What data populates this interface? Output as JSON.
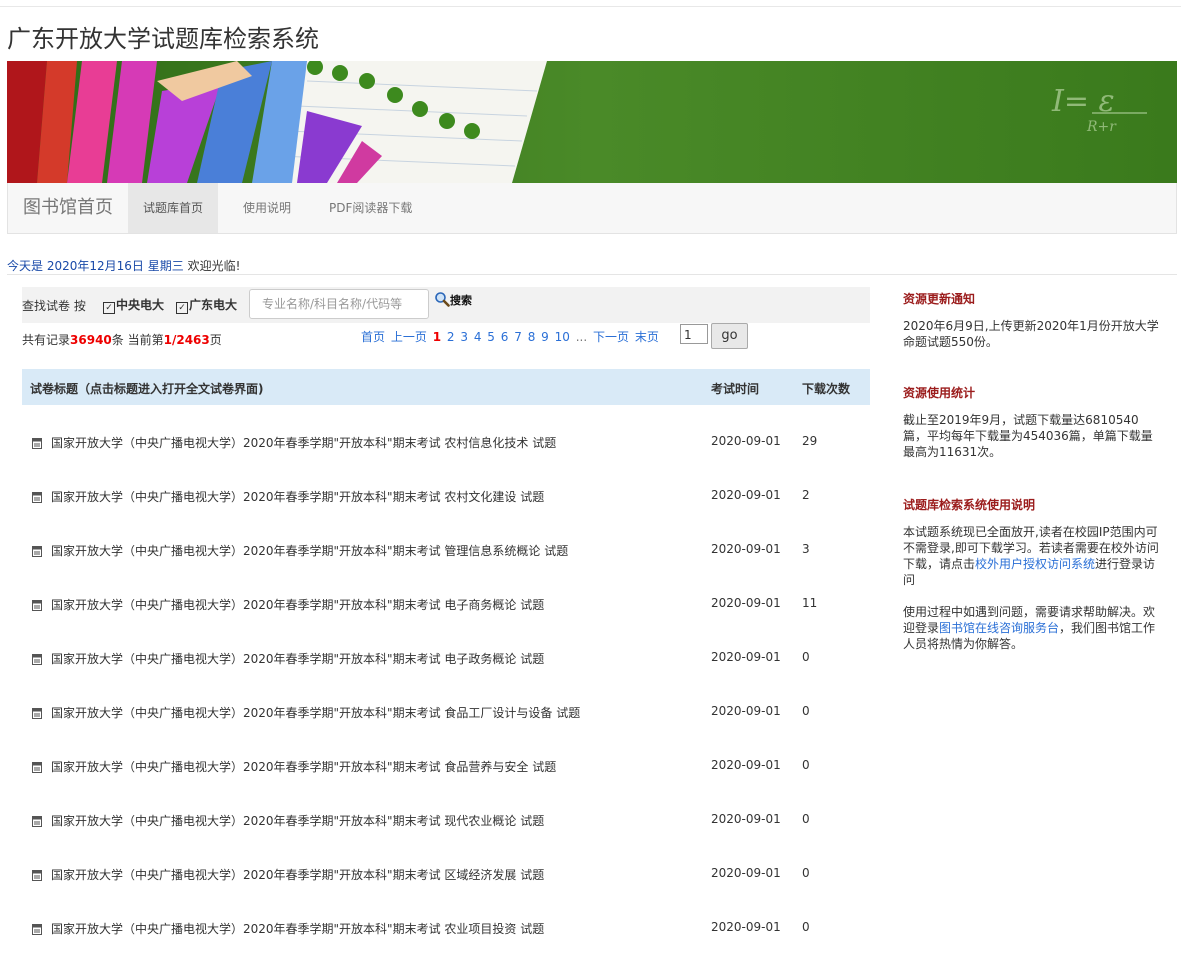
{
  "site_title": "广东开放大学试题库检索系统",
  "nav": {
    "brand": "图书馆首页",
    "items": [
      "试题库首页",
      "使用说明",
      "PDF阅读器下载"
    ]
  },
  "date_line": {
    "prefix": "今天是",
    "date": "2020年12月16日",
    "weekday": "星期三",
    "welcome": "欢迎光临!"
  },
  "search": {
    "label": "查找试卷 按",
    "check1": "中央电大",
    "check2": "广东电大",
    "placeholder": "专业名称/科目名称/代码等",
    "button": "搜索"
  },
  "records": {
    "prefix": "共有记录",
    "total": "36940",
    "mid": "条 当前第",
    "current": "1",
    "slash": "/",
    "pages": "2463",
    "suffix": "页"
  },
  "pager": {
    "first": "首页",
    "prev": "上一页",
    "pages": [
      "1",
      "2",
      "3",
      "4",
      "5",
      "6",
      "7",
      "8",
      "9",
      "10"
    ],
    "dots": "...",
    "next": "下一页",
    "last": "末页",
    "input_value": "1",
    "go": "go"
  },
  "table": {
    "headers": [
      "试卷标题（点击标题进入打开全文试卷界面)",
      "考试时间",
      "下载次数"
    ],
    "rows": [
      {
        "title": "国家开放大学（中央广播电视大学）2020年春季学期\"开放本科\"期末考试 农村信息化技术 试题",
        "date": "2020-09-01",
        "count": "29"
      },
      {
        "title": "国家开放大学（中央广播电视大学）2020年春季学期\"开放本科\"期末考试 农村文化建设 试题",
        "date": "2020-09-01",
        "count": "2"
      },
      {
        "title": "国家开放大学（中央广播电视大学）2020年春季学期\"开放本科\"期末考试 管理信息系统概论 试题",
        "date": "2020-09-01",
        "count": "3"
      },
      {
        "title": "国家开放大学（中央广播电视大学）2020年春季学期\"开放本科\"期末考试 电子商务概论 试题",
        "date": "2020-09-01",
        "count": "11"
      },
      {
        "title": "国家开放大学（中央广播电视大学）2020年春季学期\"开放本科\"期末考试 电子政务概论 试题",
        "date": "2020-09-01",
        "count": "0"
      },
      {
        "title": "国家开放大学（中央广播电视大学）2020年春季学期\"开放本科\"期末考试 食品工厂设计与设备 试题",
        "date": "2020-09-01",
        "count": "0"
      },
      {
        "title": "国家开放大学（中央广播电视大学）2020年春季学期\"开放本科\"期末考试 食品营养与安全 试题",
        "date": "2020-09-01",
        "count": "0"
      },
      {
        "title": "国家开放大学（中央广播电视大学）2020年春季学期\"开放本科\"期末考试 现代农业概论 试题",
        "date": "2020-09-01",
        "count": "0"
      },
      {
        "title": "国家开放大学（中央广播电视大学）2020年春季学期\"开放本科\"期末考试 区域经济发展 试题",
        "date": "2020-09-01",
        "count": "0"
      },
      {
        "title": "国家开放大学（中央广播电视大学）2020年春季学期\"开放本科\"期末考试 农业项目投资 试题",
        "date": "2020-09-01",
        "count": "0"
      }
    ]
  },
  "sidebar": {
    "notice_title": "资源更新通知",
    "notice_text": "2020年6月9日,上传更新2020年1月份开放大学命题试题550份。",
    "stats_title": "资源使用统计",
    "stats_text": "截止至2019年9月，试题下载量达6810540篇，平均每年下载量为454036篇，单篇下载量最高为11631次。",
    "help_title": "试题库检索系统使用说明",
    "help_p1_a": "本试题系统现已全面放开,读者在校园IP范围内可不需登录,即可下载学习。若读者需要在校外访问下载，请点击",
    "help_p1_link": "校外用户授权访问系统",
    "help_p1_b": "进行登录访问",
    "help_p2_a": "使用过程中如遇到问题，需要请求帮助解决。欢迎登录",
    "help_p2_link": "图书馆在线咨询服务台",
    "help_p2_b": "，我们图书馆工作人员将热情为你解答。"
  },
  "colors": {
    "link": "#2a6fd6",
    "highlight_red": "#e00000",
    "sidebar_heading": "#9b1c1c",
    "table_header_bg": "#d9eaf7",
    "banner_green": "#3e7d1f"
  },
  "icons": [
    "document-icon",
    "search-icon",
    "checkbox-icon"
  ]
}
